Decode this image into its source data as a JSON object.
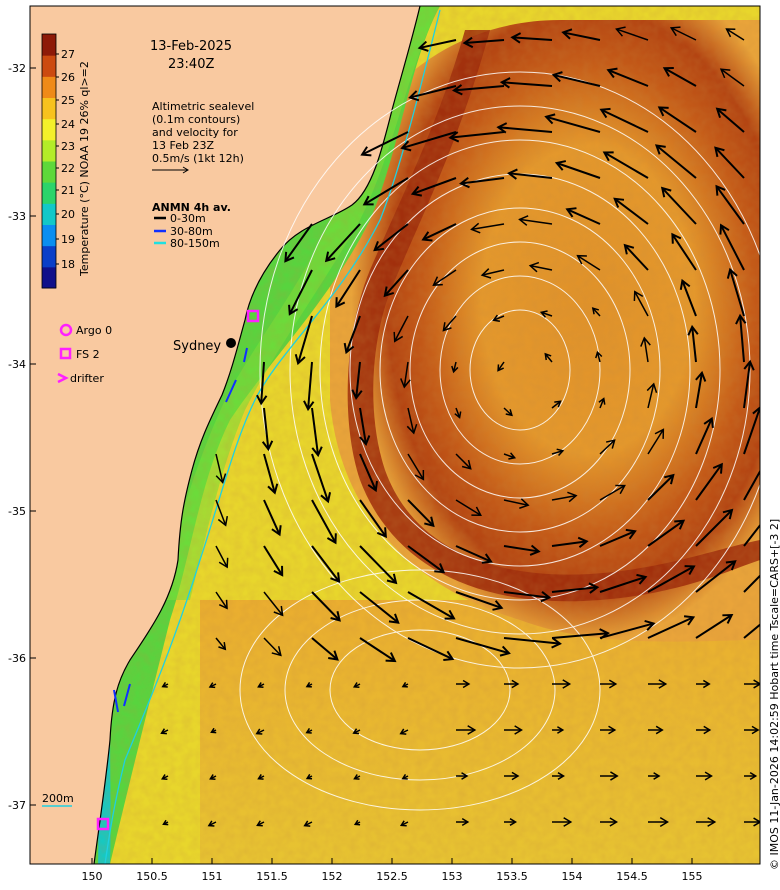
{
  "header": {
    "date": "13-Feb-2025",
    "time": "23:40Z"
  },
  "altimetry_note": [
    "Altimetric sealevel",
    "(0.1m contours)",
    "and velocity for",
    "13 Feb 23Z",
    "0.5m/s (1kt 12h)"
  ],
  "anmn": {
    "title": "ANMN 4h av.",
    "items": [
      {
        "label": "0-30m",
        "color": "#000000"
      },
      {
        "label": "30-80m",
        "color": "#1030ff"
      },
      {
        "label": "80-150m",
        "color": "#20e0e0"
      }
    ]
  },
  "legend": {
    "argo": "Argo 0",
    "fs": "FS 2",
    "drifter": "drifter"
  },
  "places": {
    "sydney": "Sydney",
    "depth_label": "200m"
  },
  "colorbar": {
    "title": "Temperature (°C) NOAA 19 26% ql>=2",
    "ticks": [
      "18",
      "19",
      "20",
      "21",
      "22",
      "23",
      "24",
      "25",
      "26",
      "27"
    ],
    "colors": [
      "#10108a",
      "#0a3fc8",
      "#0a8ef0",
      "#12c8c8",
      "#2bd46a",
      "#5ed83a",
      "#b4ec28",
      "#f4f02a",
      "#f7c21e",
      "#ef8a18",
      "#cc4a10",
      "#8e1a08"
    ]
  },
  "credit": "© IMOS 11-Jan-2026 14:02:59 Hobart time Tscale=CARS+[-3 2]",
  "axes": {
    "lon_ticks": [
      "150",
      "150.5",
      "151",
      "151.5",
      "152",
      "152.5",
      "153",
      "153.5",
      "154",
      "154.5",
      "155"
    ],
    "lat_ticks": [
      "-32",
      "-33",
      "-34",
      "-35",
      "-36",
      "-37"
    ]
  },
  "colors": {
    "land": "#f9c9a0",
    "shelf": "#4fd34a",
    "warm": "#e8a02a",
    "core": "#b84010"
  }
}
